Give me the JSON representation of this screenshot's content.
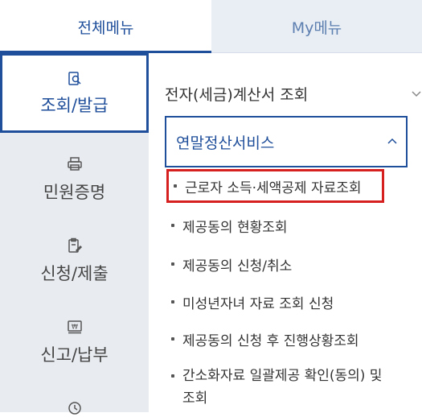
{
  "tabs": {
    "all_menu": "전체메뉴",
    "my_menu": "My메뉴"
  },
  "categories": [
    {
      "label": "조회/발급",
      "icon": "search-document-icon",
      "active": true
    },
    {
      "label": "민원증명",
      "icon": "printer-icon"
    },
    {
      "label": "신청/제출",
      "icon": "clipboard-pen-icon"
    },
    {
      "label": "신고/납부",
      "icon": "receipt-icon"
    },
    {
      "label": "",
      "icon": "clock-icon"
    }
  ],
  "menu": {
    "item1": "전자(세금)계산서 조회",
    "item2": "연말정산서비스",
    "sub": [
      "근로자 소득·세액공제 자료조회",
      "제공동의 현황조회",
      "제공동의 신청/취소",
      "미성년자녀 자료 조회 신청",
      "제공동의 신청 후 진행상황조회",
      "간소화자료 일괄제공 확인(동의) 및 조회"
    ]
  },
  "colors": {
    "accent": "#1f4e9a",
    "highlight": "#d62020",
    "sidebar_bg": "#e8ecf1",
    "my_tab_bg": "#e9eef5"
  }
}
